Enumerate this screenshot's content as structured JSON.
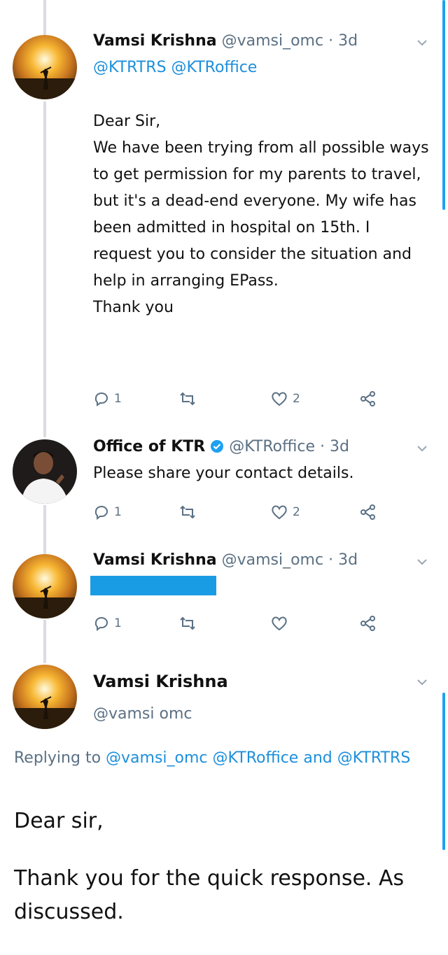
{
  "tweets": [
    {
      "name": "Vamsi Krishna",
      "handle": "@vamsi_omc",
      "sep": "·",
      "time": "3d",
      "mentions": "@KTRTRS @KTRoffice",
      "body": [
        "Dear Sir,",
        "We have been trying from all possible ways to get permission for my parents to travel, but it's a dead-end everyone. My wife has been admitted in hospital on 15th. I request you to consider the situation and help in arranging EPass.",
        "Thank you"
      ],
      "reply_count": "1",
      "retweet_count": "",
      "like_count": "2"
    },
    {
      "name": "Office of KTR",
      "handle": "@KTRoffice",
      "sep": "·",
      "time": "3d",
      "body": [
        "Please share your contact details."
      ],
      "reply_count": "1",
      "retweet_count": "",
      "like_count": "2"
    },
    {
      "name": "Vamsi Krishna",
      "handle": "@vamsi_omc",
      "sep": "·",
      "time": "3d",
      "reply_count": "1",
      "retweet_count": "",
      "like_count": ""
    }
  ],
  "focused_tweet": {
    "name": "Vamsi Krishna",
    "handle": "@vamsi omc",
    "replying_prefix": "Replying to",
    "replying_mention_1": "@vamsi_omc",
    "replying_mention_2": "@KTRoffice",
    "replying_and": "and",
    "replying_mention_3": "@KTRTRS",
    "body": [
      "Dear sir,",
      "Thank you for the quick response. As discussed."
    ]
  },
  "colors": {
    "link": "#1d8fdb",
    "muted": "#5b7083",
    "redaction": "#1a9ce4",
    "scrollbar": "#1da1f2"
  },
  "icons": [
    "reply-icon",
    "retweet-icon",
    "like-icon",
    "share-icon",
    "chevron-down-icon",
    "verified-badge-icon"
  ]
}
